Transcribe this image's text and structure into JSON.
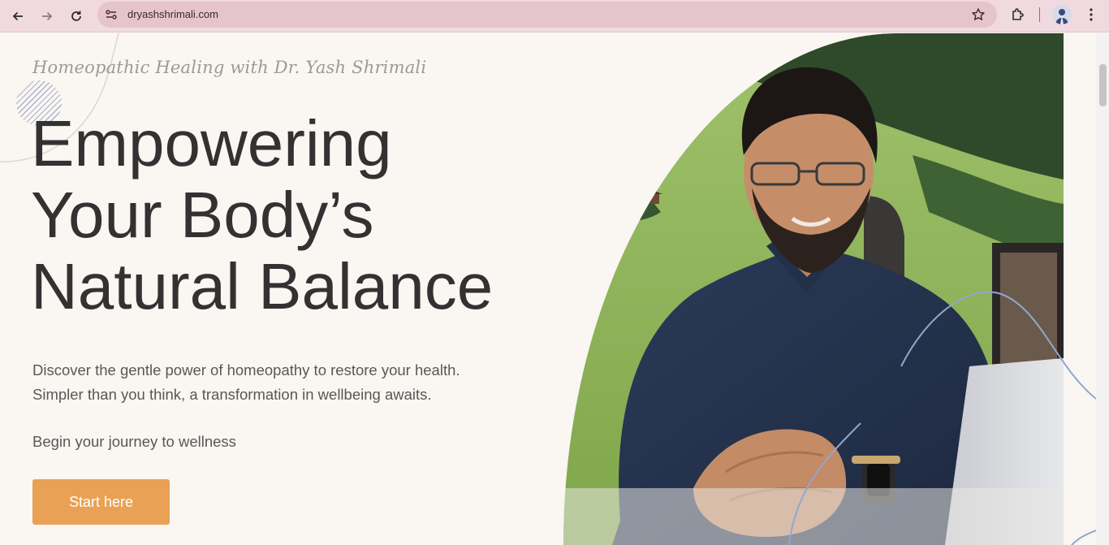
{
  "browser": {
    "url": "dryashshrimali.com",
    "icons": [
      "back-arrow-icon",
      "forward-arrow-icon",
      "reload-icon",
      "site-info-icon",
      "bookmark-star-icon",
      "extensions-icon",
      "profile-avatar",
      "kebab-menu-icon"
    ]
  },
  "hero": {
    "eyebrow": "Homeopathic Healing with Dr. Yash Shrimali",
    "headline_line1": "Empowering",
    "headline_line2": "Your Body’s",
    "headline_line3": "Natural Balance",
    "lead_line1": "Discover the gentle power of homeopathy to restore your health.",
    "lead_line2": "Simpler than you think, a transformation in wellbeing awaits.",
    "subtext": "Begin your journey to wellness",
    "cta_label": "Start here"
  },
  "colors": {
    "page_bg": "#faf6f2",
    "chrome_bg": "#f1dadf",
    "headline": "#333132",
    "cta": "#e9a155",
    "accent_line": "#8fa8d0"
  }
}
